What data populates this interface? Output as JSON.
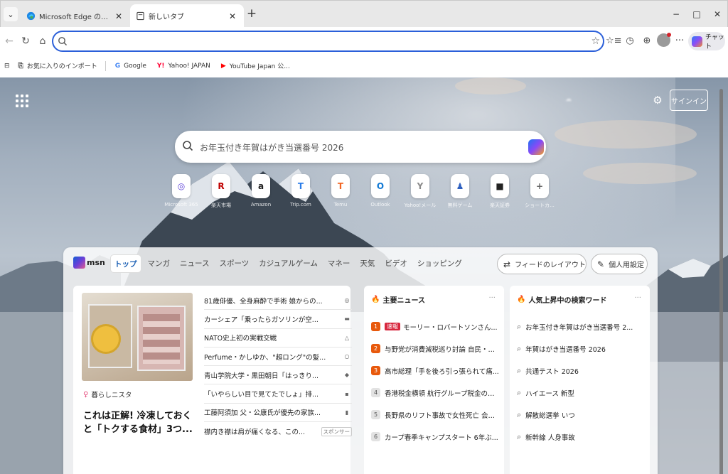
{
  "tabs": {
    "menu_icon": "chevron-down-icon",
    "items": [
      {
        "title": "Microsoft Edge の新機能",
        "icon": "edge-logo-icon",
        "active": false
      },
      {
        "title": "新しいタブ",
        "icon": "page-icon",
        "active": true
      }
    ],
    "new_tab": "+"
  },
  "window": {
    "minimize": "−",
    "maximize": "□",
    "close": "✕"
  },
  "toolbar": {
    "address_value": "",
    "address_placeholder": "",
    "icons": [
      "back-icon",
      "refresh-icon",
      "home-icon",
      "favorite-star-icon",
      "favorites-icon",
      "history-icon",
      "extensions-icon",
      "profile-icon",
      "more-icon"
    ],
    "chat_label": "チャット"
  },
  "bookmarks": [
    {
      "label": "お気に入りのインポート",
      "icon": "import-icon"
    },
    {
      "label": "Google",
      "icon": "google-icon"
    },
    {
      "label": "Yahoo! JAPAN",
      "icon": "yahoo-icon"
    },
    {
      "label": "YouTube Japan 公...",
      "icon": "youtube-icon"
    }
  ],
  "newtab": {
    "signin_label": "サインイン",
    "search_placeholder": "お年玉付き年賀はがき当選番号 2026",
    "quick_links": [
      {
        "label": "Microsoft 365",
        "glyph": "◎",
        "color": "#5b3fd8"
      },
      {
        "label": "楽天市場",
        "glyph": "R",
        "color": "#bf0000"
      },
      {
        "label": "Amazon",
        "glyph": "a",
        "color": "#222222"
      },
      {
        "label": "Trip.com",
        "glyph": "T",
        "color": "#2b7de9"
      },
      {
        "label": "Temu",
        "glyph": "T",
        "color": "#f26522"
      },
      {
        "label": "Outlook",
        "glyph": "O",
        "color": "#0f78d4"
      },
      {
        "label": "Yahoo!メール",
        "glyph": "Y",
        "color": "#8a8a8a"
      },
      {
        "label": "無料ゲーム",
        "glyph": "♟",
        "color": "#2d5fbf"
      },
      {
        "label": "楽天証券",
        "glyph": "■",
        "color": "#222222"
      },
      {
        "label": "ショートカ...",
        "glyph": "+",
        "color": "#666666"
      }
    ]
  },
  "msn": {
    "logo": "msn",
    "nav": [
      "トップ",
      "マンガ",
      "ニュース",
      "スポーツ",
      "カジュアルゲーム",
      "マネー",
      "天気",
      "ビデオ",
      "ショッピング"
    ],
    "feed_layout_label": "フィードのレイアウト",
    "personalize_label": "個人用設定",
    "featured": {
      "category": "暮らしニスタ",
      "headline": "これは正解! 冷凍しておくと「トクする食材」3つ..."
    },
    "news": [
      {
        "title": "81歳俳優、全身麻酔で手術 娘からの...",
        "badge": "◎"
      },
      {
        "title": "カーシェア「乗ったらガソリンが空...",
        "badge": "▬"
      },
      {
        "title": "NATO史上初の実戦交戦",
        "badge": "△"
      },
      {
        "title": "Perfume・かしゆか、\"超ロング\"の髪...",
        "badge": "○"
      },
      {
        "title": "青山学院大学・黒田朝日「はっきり...",
        "badge": "◆"
      },
      {
        "title": "「いやらしい目で見てたでしょ」排...",
        "badge": "▪"
      },
      {
        "title": "工藤阿須加 父・公康氏が優先の家族...",
        "badge": "▮"
      },
      {
        "title": "襟内き襟は肩が痛くなる、この...",
        "badge": "",
        "sponsor": "スポンサー"
      }
    ],
    "top_news": {
      "title": "主要ニュース",
      "more": "···",
      "items": [
        {
          "num": "1",
          "tag": "速報",
          "title": "モーリー・ロバートソンさん..."
        },
        {
          "num": "2",
          "title": "与野党が消費減税巡り討論 自民・田..."
        },
        {
          "num": "3",
          "title": "高市総理「手を後ろ引っ張られて痛..."
        },
        {
          "num": "4",
          "title": "香港税金横領 航行グループ税金の移..."
        },
        {
          "num": "5",
          "title": "長野県のリフト事故で女性死亡 会社..."
        },
        {
          "num": "6",
          "title": "カープ春季キャンプスタート 6年ぶ..."
        }
      ]
    },
    "trending": {
      "title": "人気上昇中の検索ワード",
      "more": "···",
      "items": [
        "お年玉付き年賀はがき当選番号 2...",
        "年賀はがき当選番号 2026",
        "共通テスト 2026",
        "ハイエース 新型",
        "解散総選挙 いつ",
        "新幹線 人身事故"
      ]
    }
  }
}
